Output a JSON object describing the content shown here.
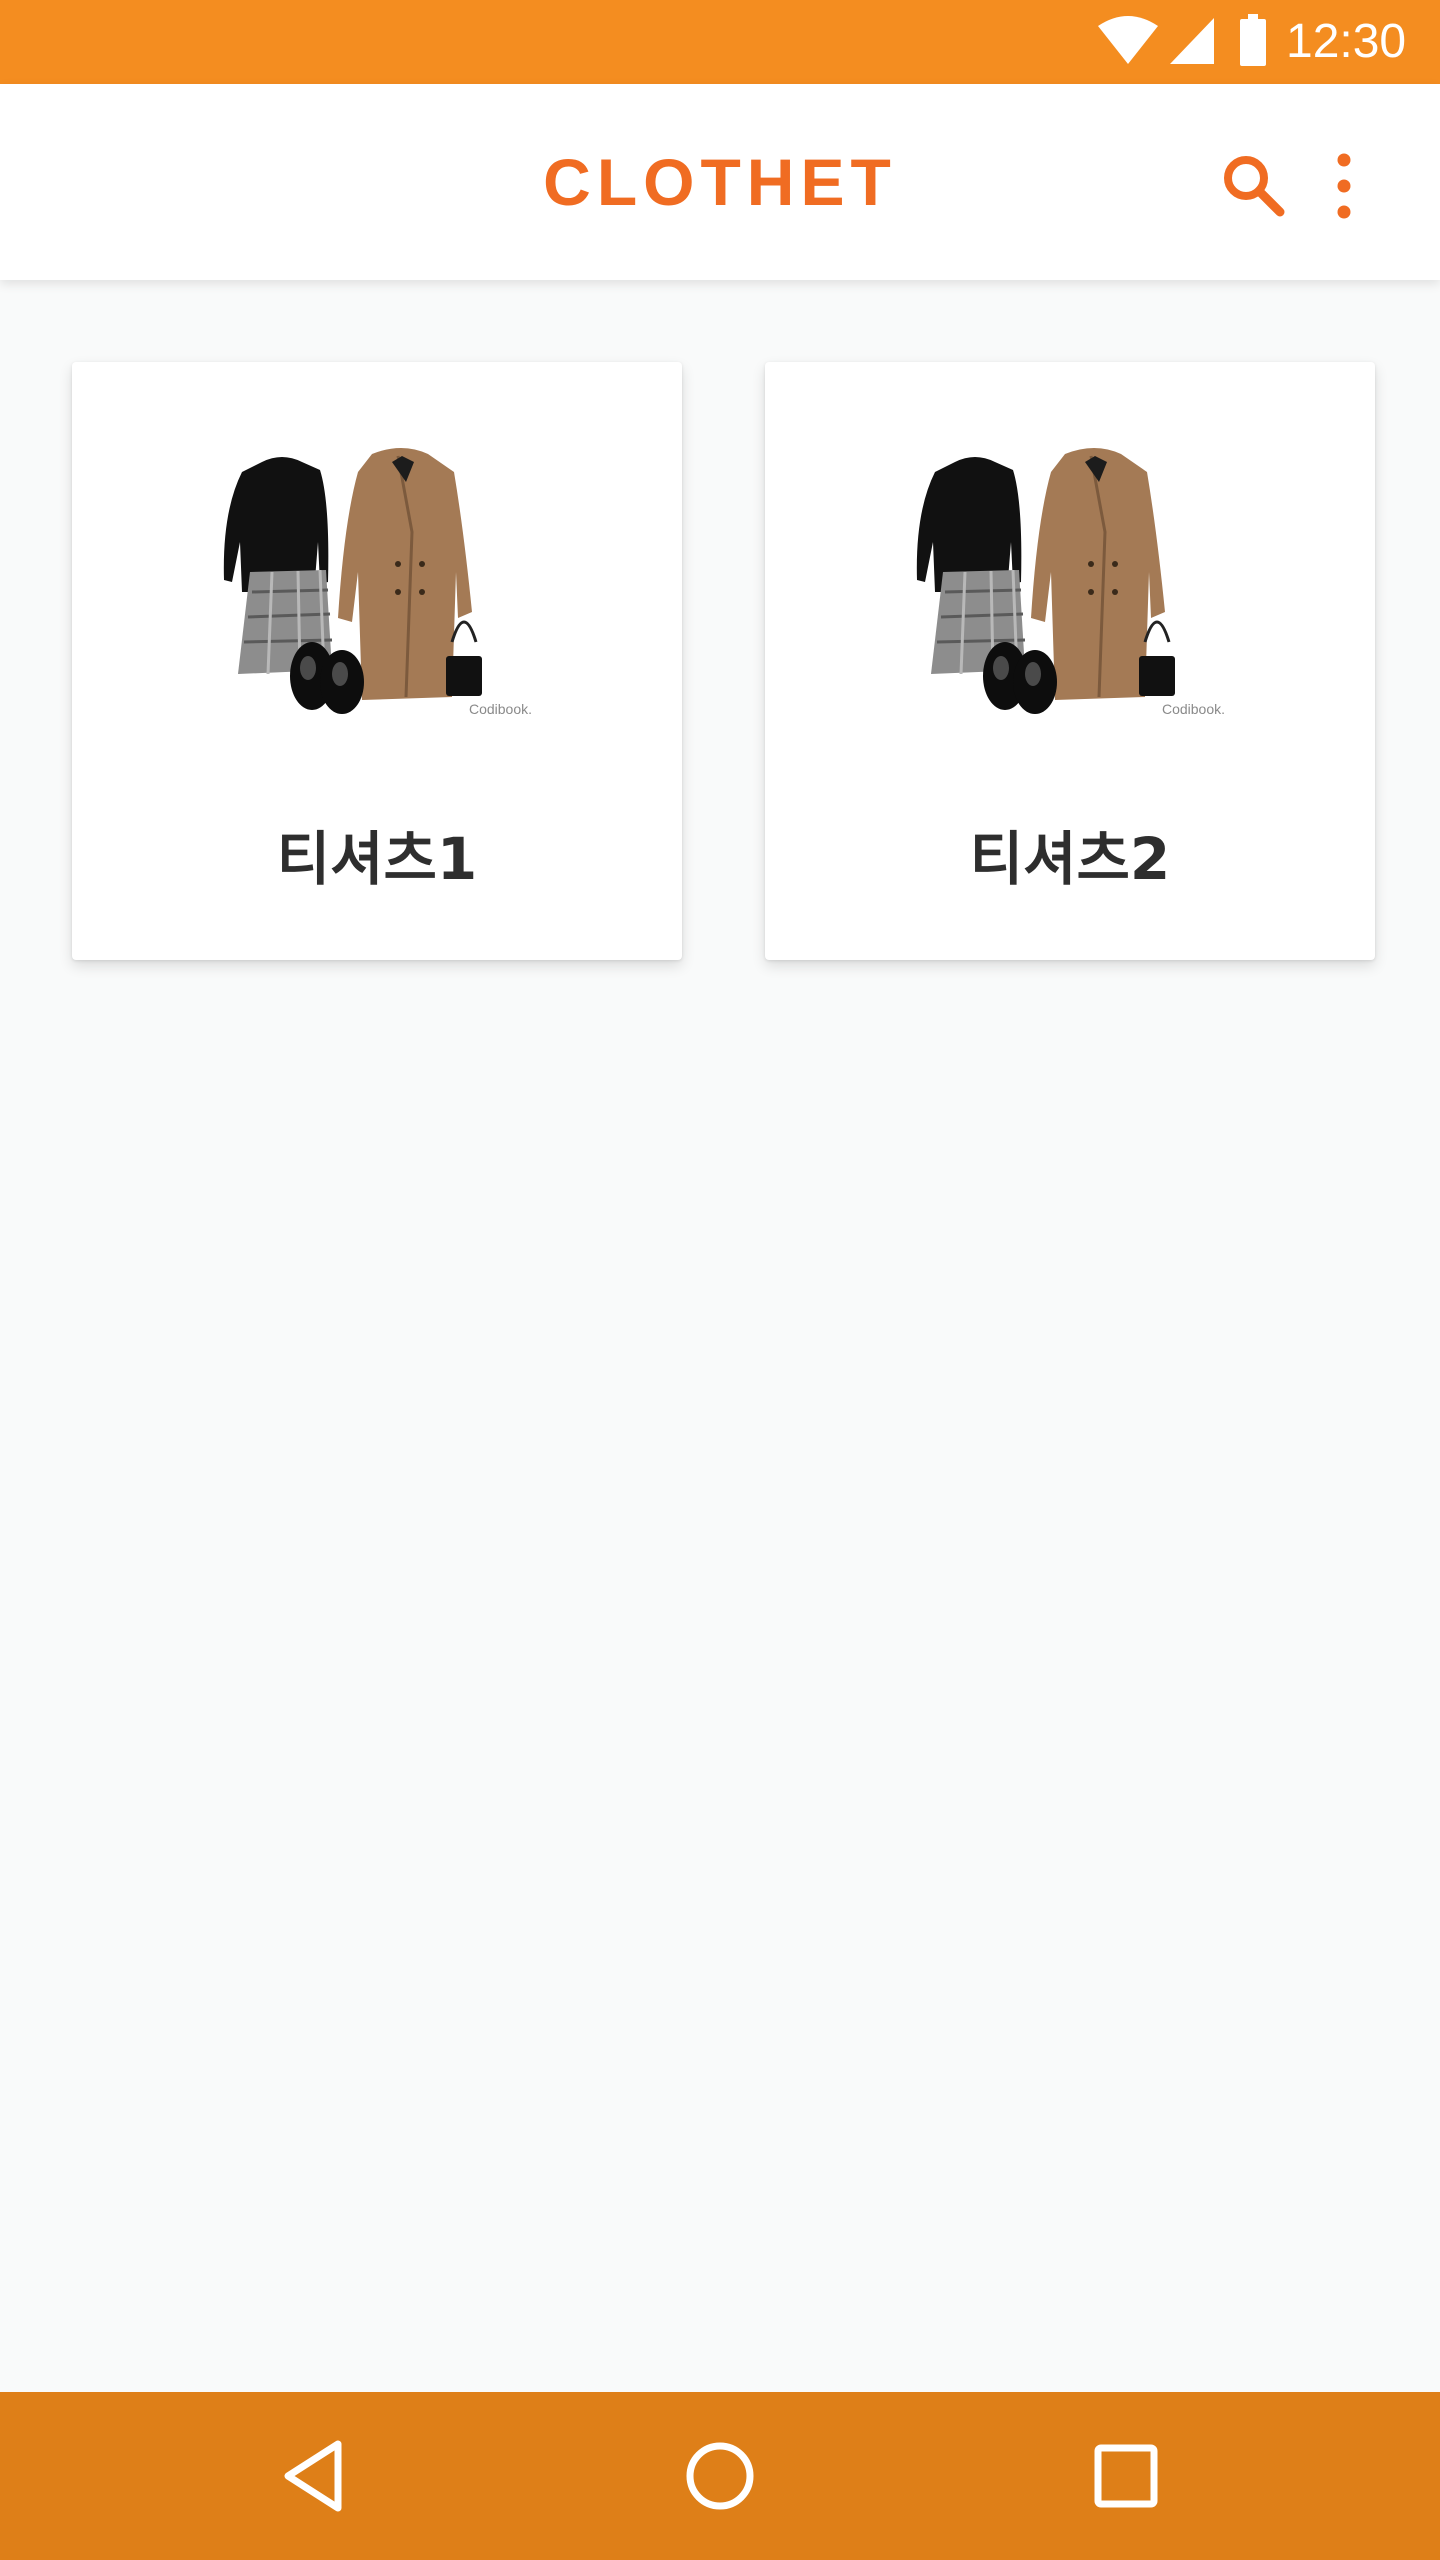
{
  "status_bar": {
    "time": "12:30",
    "background": "#f48d20",
    "icons": [
      "wifi-icon",
      "cell-signal-icon",
      "battery-icon"
    ]
  },
  "app_bar": {
    "title": "CLOTHET",
    "title_color": "#f06c22",
    "actions": [
      "search-icon",
      "more-vert-icon"
    ]
  },
  "cards": [
    {
      "label": "티셔츠1",
      "image_caption": "Codibook."
    },
    {
      "label": "티셔츠2",
      "image_caption": "Codibook."
    }
  ],
  "nav_bar": {
    "background": "#de7f18",
    "buttons": [
      "back-icon",
      "home-icon",
      "recent-apps-icon"
    ]
  }
}
